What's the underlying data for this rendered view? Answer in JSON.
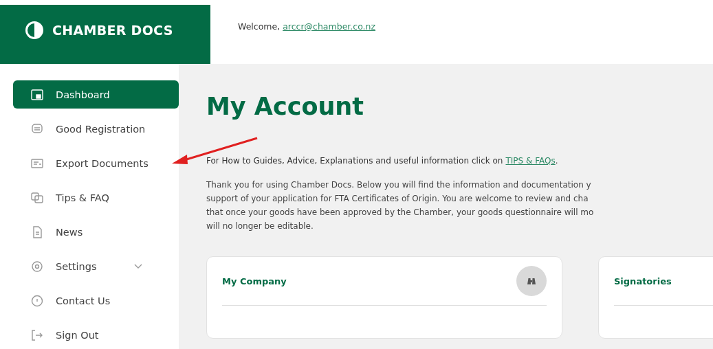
{
  "brand": {
    "name": "CHAMBER DOCS"
  },
  "header": {
    "greeting": "Welcome,",
    "user_link": "arccr@chamber.co.nz"
  },
  "sidebar": {
    "items": [
      {
        "label": "Dashboard",
        "kind": "link",
        "selected": true
      },
      {
        "label": "Good Registration",
        "kind": "link",
        "selected": false
      },
      {
        "label": "Export Documents",
        "kind": "link",
        "selected": false
      },
      {
        "label": "Tips & FAQ",
        "kind": "link",
        "selected": false
      },
      {
        "label": "News",
        "kind": "link",
        "selected": false
      },
      {
        "label": "Settings",
        "kind": "group",
        "selected": false
      },
      {
        "label": "Contact Us",
        "kind": "link",
        "selected": false
      },
      {
        "label": "Sign Out",
        "kind": "link",
        "selected": false
      }
    ]
  },
  "page": {
    "title": "My Account",
    "info": {
      "text": "For How to Guides, Advice, Explanations and useful information click on",
      "link": "TIPS & FAQs",
      "suffix": "."
    },
    "paragraph_lines": [
      "Thank you for using Chamber Docs. Below you will find the information and documentation y",
      "support of your application for FTA Certificates of Origin. You are welcome to review and cha",
      "that once your goods have been approved by the Chamber, your goods questionnaire will mo",
      "will no longer be editable."
    ],
    "cards": [
      {
        "title": "My Company",
        "kind": "action"
      },
      {
        "title": "Signatories",
        "kind": "plain"
      }
    ]
  }
}
